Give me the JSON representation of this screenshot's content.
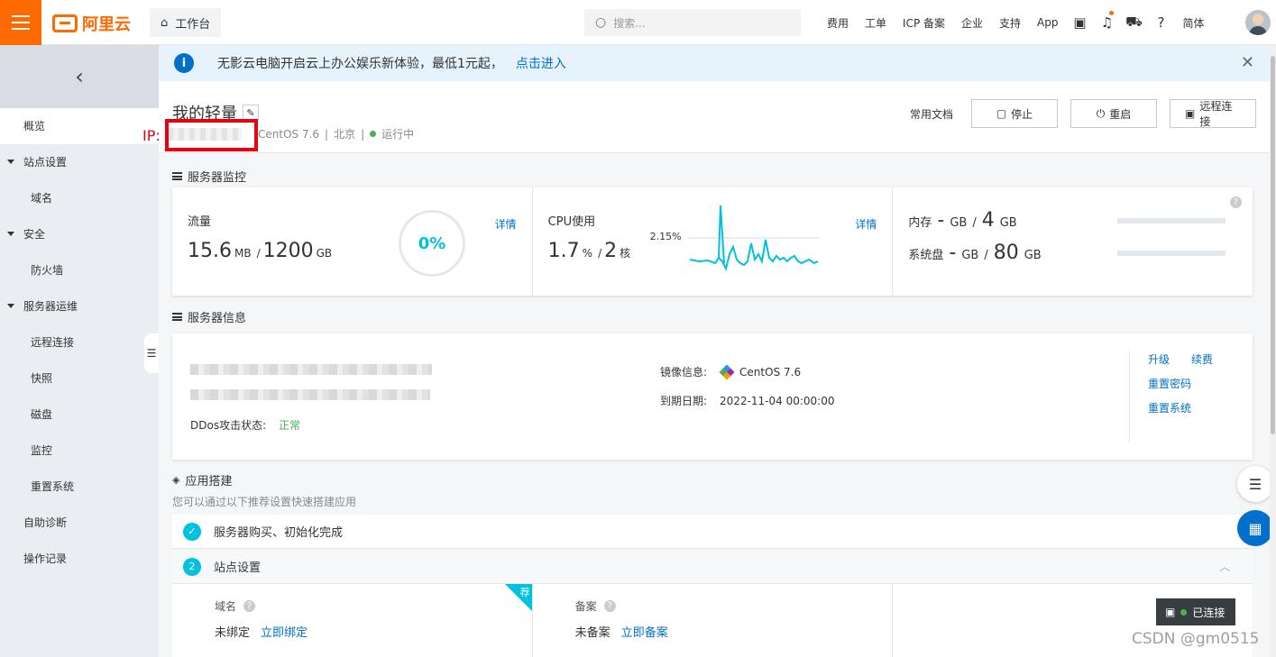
{
  "topbar": {
    "logo_text": "阿里云",
    "workbench": "工作台",
    "search_placeholder": "搜索...",
    "nav": [
      "费用",
      "工单",
      "ICP 备案",
      "企业",
      "支持",
      "App"
    ],
    "lang": "简体",
    "icons": [
      "terminal-icon",
      "bell-icon",
      "cart-icon",
      "help-icon"
    ]
  },
  "sidebar": {
    "items": [
      {
        "label": "概览",
        "type": "active"
      },
      {
        "label": "站点设置",
        "type": "group"
      },
      {
        "label": "域名",
        "type": "sub"
      },
      {
        "label": "安全",
        "type": "group"
      },
      {
        "label": "防火墙",
        "type": "sub"
      },
      {
        "label": "服务器运维",
        "type": "group"
      },
      {
        "label": "远程连接",
        "type": "sub"
      },
      {
        "label": "快照",
        "type": "sub"
      },
      {
        "label": "磁盘",
        "type": "sub"
      },
      {
        "label": "监控",
        "type": "sub"
      },
      {
        "label": "重置系统",
        "type": "sub"
      },
      {
        "label": "自助诊断",
        "type": "item"
      },
      {
        "label": "操作记录",
        "type": "item"
      }
    ]
  },
  "notice": {
    "text": "无影云电脑开启云上办公娱乐新体验，最低1元起，",
    "link": "点击进入"
  },
  "header": {
    "title": "我的轻量",
    "ip_label": "IP:",
    "os": "CentOS 7.6",
    "region": "北京",
    "status": "运行中",
    "doc_link": "常用文档",
    "buttons": [
      "停止",
      "重启",
      "远程连接"
    ]
  },
  "monitor": {
    "section_title": "服务器监控",
    "traffic": {
      "label": "流量",
      "used": "15.6",
      "used_unit": "MB",
      "total": "1200",
      "total_unit": "GB",
      "percent": "0%",
      "detail": "详情"
    },
    "cpu": {
      "label": "CPU使用",
      "value": "1.7",
      "unit": "%",
      "cores": "2",
      "cores_unit": "核",
      "peak": "2.15%",
      "detail": "详情"
    },
    "memory": {
      "label": "内存",
      "used": "-",
      "used_unit": "GB",
      "total": "4",
      "total_unit": "GB"
    },
    "disk": {
      "label": "系统盘",
      "used": "-",
      "used_unit": "GB",
      "total": "80",
      "total_unit": "GB"
    }
  },
  "server_info": {
    "section_title": "服务器信息",
    "ddos_label": "DDos攻击状态:",
    "ddos_value": "正常",
    "image_label": "镜像信息:",
    "image_value": "CentOS 7.6",
    "expire_label": "到期日期:",
    "expire_value": "2022-11-04 00:00:00",
    "links": [
      "升级",
      "续费",
      "重置密码",
      "重置系统"
    ]
  },
  "app_setup": {
    "section_title": "应用搭建",
    "subtitle": "您可以通过以下推荐设置快速搭建应用",
    "step1": "服务器购买、初始化完成",
    "step2_num": "2",
    "step2": "站点设置",
    "domain_label": "域名",
    "domain_value": "未绑定",
    "domain_link": "立即绑定",
    "recommend": "荐",
    "icp_label": "备案",
    "icp_value": "未备案",
    "icp_link": "立即备案"
  },
  "connected": "已连接",
  "watermark": "CSDN @gm0515"
}
